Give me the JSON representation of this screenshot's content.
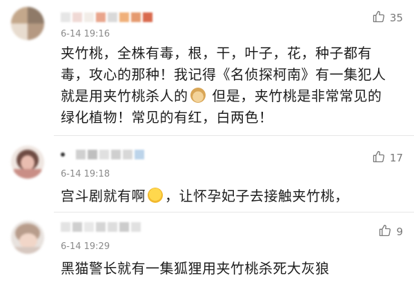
{
  "comments": [
    {
      "time": "6-14 19:16",
      "likes": "35",
      "text_a": "夹竹桃，全株有毒，根，干，叶子，花，种子都有毒，攻心的那种！我记得《名侦探柯南》有一集犯人就是用夹竹桃杀人的",
      "emoji": "doge-emoji",
      "text_b": " 但是，夹竹桃是非常常见的绿化植物！常见的有红，白两色！"
    },
    {
      "time": "6-14 19:18",
      "likes": "17",
      "text_a": "宫斗剧就有啊",
      "emoji": "laugh-cry-emoji",
      "text_b": "，让怀孕妃子去接触夹竹桃，"
    },
    {
      "time": "6-14 19:29",
      "likes": "9",
      "text_a": "黑猫警长就有一集狐狸用夹竹桃杀死大灰狼"
    }
  ],
  "icons": {
    "like": "thumbs-up-icon"
  },
  "colors": {
    "text": "#1c1c1c",
    "meta": "#8a8a8a",
    "divider": "#e6e6e6"
  }
}
